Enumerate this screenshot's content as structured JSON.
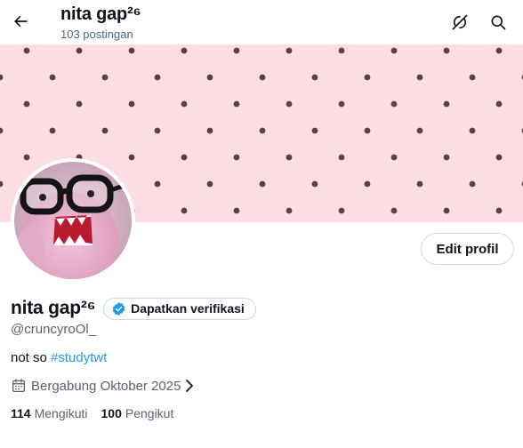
{
  "header": {
    "title": "nita gap²⁶",
    "post_count": "103 postingan",
    "icons": [
      "back-arrow-icon",
      "refresh-off-icon",
      "search-icon"
    ]
  },
  "banner": {
    "background_color": "#fbdde3",
    "dot_color": "#5e3f44"
  },
  "avatar": {
    "description_icon": "pink-monster-plush-with-glasses"
  },
  "actions": {
    "edit_profile_label": "Edit profil"
  },
  "profile": {
    "name": "nita gap²⁶",
    "verify_label": "Dapatkan verifikasi",
    "handle": "@cruncyroOl_",
    "bio_text": "not so ",
    "bio_hashtag": "#studytwt",
    "joined_label": "Bergabung Oktober 2025",
    "following_count": "114",
    "following_label": "Mengikuti",
    "followers_count": "100",
    "followers_label": "Pengikut"
  },
  "colors": {
    "accent": "#1d9bf0",
    "text_primary": "#0f1419",
    "text_secondary": "#536471",
    "border": "#cfd9de"
  }
}
